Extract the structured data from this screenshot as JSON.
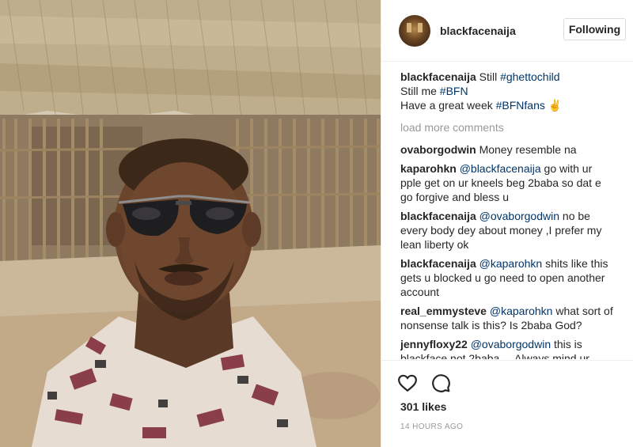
{
  "post": {
    "username": "blackfacenaija",
    "follow_label": "Following"
  },
  "caption": {
    "user": "blackfacenaija",
    "line1_text": "Still ",
    "line1_tag": "#ghettochild",
    "line2_text": "Still me ",
    "line2_tag": "#BFN",
    "line3_text": "Have a great week ",
    "line3_tag": "#BFNfans",
    "line3_emoji": "✌"
  },
  "load_more_label": "load more comments",
  "comments": [
    {
      "user": "ovaborgodwin",
      "mention": "",
      "text": "Money resemble na"
    },
    {
      "user": "kaparohkn",
      "mention": "@blackfacenaija",
      "text": "go with ur pple get on ur kneels beg 2baba so dat e go forgive and bless u"
    },
    {
      "user": "blackfacenaija",
      "mention": "@ovaborgodwin",
      "text": "no be every body dey about money ,I prefer my lean liberty ok"
    },
    {
      "user": "blackfacenaija",
      "mention": "@kaparohkn",
      "text": "shits like this gets u blocked u go need to open another account"
    },
    {
      "user": "real_emmysteve",
      "mention": "@kaparohkn",
      "text": "what sort of nonsense talk is this? Is 2baba God?"
    },
    {
      "user": "jennyfloxy22",
      "mention": "@ovaborgodwin",
      "text": "this is blackface not 2baba ... Always mind ur"
    }
  ],
  "actions": {
    "like_icon": "heart-icon",
    "comment_icon": "comment-bubble-icon"
  },
  "likes_label": "301 likes",
  "timestamp": "14 HOURS AGO",
  "colors": {
    "link": "#003569",
    "muted": "#999999",
    "border": "#efefef",
    "text": "#262626"
  }
}
